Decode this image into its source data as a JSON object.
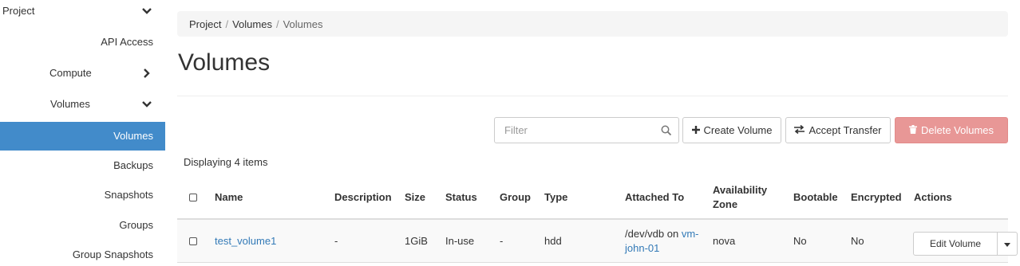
{
  "sidebar": {
    "items": [
      {
        "label": "Project"
      },
      {
        "label": "API Access"
      },
      {
        "label": "Compute"
      },
      {
        "label": "Volumes"
      },
      {
        "label": "Volumes"
      },
      {
        "label": "Backups"
      },
      {
        "label": "Snapshots"
      },
      {
        "label": "Groups"
      },
      {
        "label": "Group Snapshots"
      }
    ]
  },
  "breadcrumb": {
    "items": [
      "Project",
      "Volumes",
      "Volumes"
    ],
    "separator": "/"
  },
  "page": {
    "title": "Volumes"
  },
  "toolbar": {
    "filter_placeholder": "Filter",
    "create_label": "Create Volume",
    "accept_label": "Accept Transfer",
    "delete_label": "Delete Volumes"
  },
  "table": {
    "displaying": "Displaying 4 items",
    "columns": [
      "Name",
      "Description",
      "Size",
      "Status",
      "Group",
      "Type",
      "Attached To",
      "Availability Zone",
      "Bootable",
      "Encrypted",
      "Actions"
    ],
    "availability_line1": "Availability",
    "availability_line2": "Zone",
    "rows": [
      {
        "name": "test_volume1",
        "description": "-",
        "size": "1GiB",
        "status": "In-use",
        "group": "-",
        "type": "hdd",
        "attached_prefix": "/dev/vdb on",
        "attached_link_a": "vm-",
        "attached_link_b": "john-01",
        "zone": "nova",
        "bootable": "No",
        "encrypted": "No",
        "action_label": "Edit Volume"
      }
    ]
  },
  "colors": {
    "accent": "#428bca",
    "danger": "#e89796",
    "link": "#337ab7"
  }
}
